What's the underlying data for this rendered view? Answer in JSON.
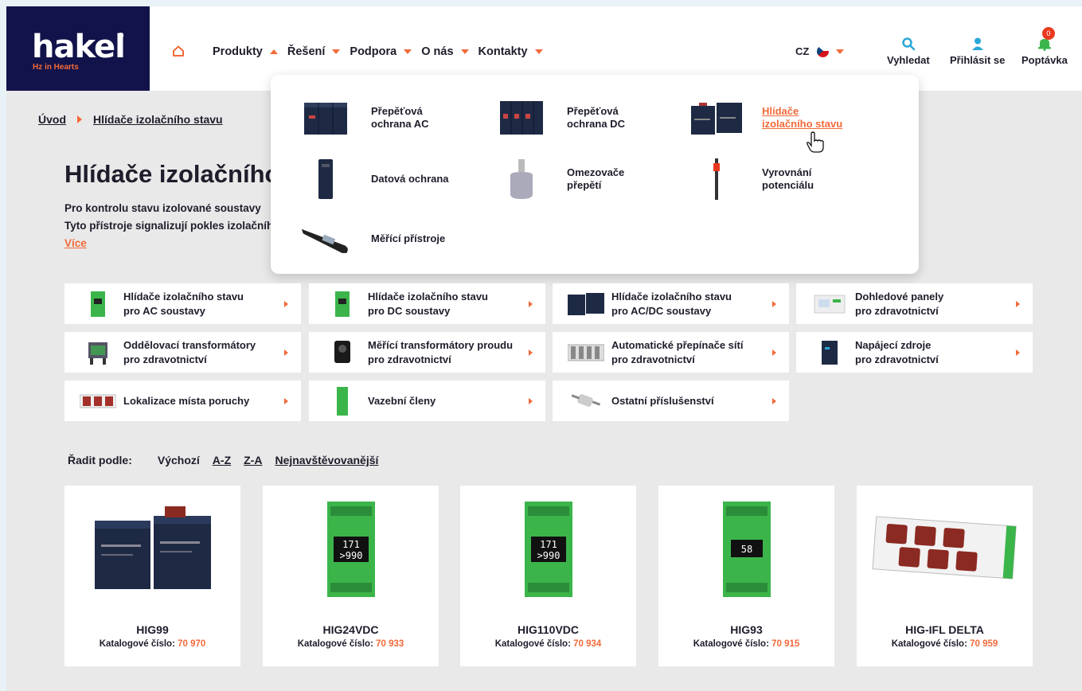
{
  "logo": {
    "word": "hakel",
    "reg": "®",
    "tagline": "Hz in Hearts"
  },
  "nav": {
    "items": [
      {
        "label": "Produkty",
        "open": true
      },
      {
        "label": "Řešení",
        "open": false
      },
      {
        "label": "Podpora",
        "open": false
      },
      {
        "label": "O nás",
        "open": false
      },
      {
        "label": "Kontakty",
        "open": false
      }
    ],
    "lang": "CZ"
  },
  "tools": {
    "search": "Vyhledat",
    "login": "Přihlásit se",
    "inquiry": "Poptávka",
    "inquiry_count": "0"
  },
  "breadcrumb": {
    "home": "Úvod",
    "current": "Hlídače izolačního stavu"
  },
  "page": {
    "title": "Hlídače izolačního stavu",
    "intro_line1": "Pro kontrolu stavu izolované soustavy",
    "intro_line2": "Tyto přístroje signalizují pokles izolačního stavu",
    "more": "Více"
  },
  "mega_menu": {
    "items": [
      {
        "line1": "Přepěťová",
        "line2": "ochrana AC",
        "icon": "surge-ac-device"
      },
      {
        "line1": "Přepěťová",
        "line2": "ochrana DC",
        "icon": "surge-dc-device"
      },
      {
        "line1": "Hlídače",
        "line2": "izolačního stavu",
        "icon": "insulation-monitor-device",
        "active": true
      },
      {
        "line1": "Datová ochrana",
        "line2": "",
        "icon": "data-protection-device"
      },
      {
        "line1": "Omezovače",
        "line2": "přepětí",
        "icon": "limiter-device"
      },
      {
        "line1": "Vyrovnání",
        "line2": "potenciálu",
        "icon": "equipotential-device"
      },
      {
        "line1": "Měřící přístroje",
        "line2": "",
        "icon": "meter-device"
      }
    ]
  },
  "categories": [
    {
      "line1": "Hlídače izolačního stavu",
      "line2": "pro AC soustavy"
    },
    {
      "line1": "Hlídače izolačního stavu",
      "line2": "pro DC soustavy"
    },
    {
      "line1": "Hlídače izolačního stavu",
      "line2": "pro AC/DC soustavy"
    },
    {
      "line1": "Dohledové panely",
      "line2": "pro zdravotnictví"
    },
    {
      "line1": "Oddělovací transformátory",
      "line2": "pro zdravotnictví"
    },
    {
      "line1": "Měřící transformátory proudu",
      "line2": "pro zdravotnictví"
    },
    {
      "line1": "Automatické přepínače sítí",
      "line2": "pro zdravotnictví"
    },
    {
      "line1": "Napájecí zdroje",
      "line2": "pro zdravotnictví"
    },
    {
      "line1": "Lokalizace místa poruchy",
      "line2": ""
    },
    {
      "line1": "Vazební členy",
      "line2": ""
    },
    {
      "line1": "Ostatní příslušenství",
      "line2": ""
    }
  ],
  "sort": {
    "label": "Řadit podle:",
    "options": [
      "Výchozí",
      "A-Z",
      "Z-A",
      "Nejnavštěvovanější"
    ]
  },
  "products": [
    {
      "name": "HIG99",
      "catalog_label": "Katalogové číslo:",
      "catalog_no": "70 970"
    },
    {
      "name": "HIG24VDC",
      "catalog_label": "Katalogové číslo:",
      "catalog_no": "70 933"
    },
    {
      "name": "HIG110VDC",
      "catalog_label": "Katalogové číslo:",
      "catalog_no": "70 934"
    },
    {
      "name": "HIG93",
      "catalog_label": "Katalogové číslo:",
      "catalog_no": "70 915"
    },
    {
      "name": "HIG-IFL DELTA",
      "catalog_label": "Katalogové číslo:",
      "catalog_no": "70 959"
    }
  ],
  "product_displays": [
    {
      "top": "171",
      "bottom": ">990"
    },
    {
      "top": "171",
      "bottom": ">990"
    },
    {
      "top": "58",
      "bottom": ""
    }
  ],
  "colors": {
    "accent": "#f26a3a",
    "brand": "#12134a",
    "green_device": "#3bb54a"
  }
}
